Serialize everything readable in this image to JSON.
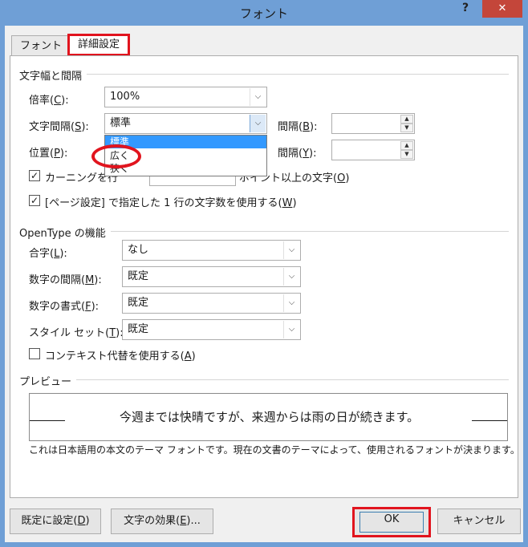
{
  "window": {
    "title": "フォント",
    "help": "?",
    "close": "✕"
  },
  "tabs": [
    {
      "label": "フォント"
    },
    {
      "label": "詳細設定"
    }
  ],
  "spacing_section": {
    "title": "文字幅と間隔",
    "scale": {
      "label": "倍率(",
      "key": "C",
      "suffix": "):",
      "value": "100%"
    },
    "spacing": {
      "label": "文字間隔(",
      "key": "S",
      "suffix": "):",
      "value": "標準"
    },
    "spacing_by": {
      "label": "間隔(",
      "key": "B",
      "suffix": "):",
      "value": ""
    },
    "position": {
      "label": "位置(",
      "key": "P",
      "suffix": "):"
    },
    "position_by": {
      "label": "間隔(",
      "key": "Y",
      "suffix": "):",
      "value": ""
    },
    "kerning": {
      "label_visible": "カーニングを行",
      "tail": "ポイント以上の文字(",
      "key": "O",
      "suffix": ")",
      "checked": true
    },
    "grid": {
      "label": "[ページ設定] で指定した 1 行の文字数を使用する(",
      "key": "W",
      "suffix": ")",
      "checked": true
    }
  },
  "dropdown": {
    "options": [
      "標準",
      "広く",
      "狭く"
    ],
    "selected": "標準"
  },
  "opentype_section": {
    "title": "OpenType の機能",
    "ligatures": {
      "label": "合字(",
      "key": "L",
      "suffix": "):",
      "value": "なし"
    },
    "number_spacing": {
      "label": "数字の間隔(",
      "key": "M",
      "suffix": "):",
      "value": "既定"
    },
    "number_forms": {
      "label": "数字の書式(",
      "key": "F",
      "suffix": "):",
      "value": "既定"
    },
    "stylistic_sets": {
      "label": "スタイル セット(",
      "key": "T",
      "suffix": "):",
      "value": "既定"
    },
    "contextual": {
      "label": "コンテキスト代替を使用する(",
      "key": "A",
      "suffix": ")",
      "checked": false
    }
  },
  "preview": {
    "title": "プレビュー",
    "sample": "今週までは快晴ですが、来週からは雨の日が続きます。",
    "note": "これは日本語用の本文のテーマ フォントです。現在の文書のテーマによって、使用されるフォントが決まります。"
  },
  "buttons": {
    "set_default": {
      "label": "既定に設定(",
      "key": "D",
      "suffix": ")"
    },
    "text_effects": {
      "label": "文字の効果(",
      "key": "E",
      "suffix": ")..."
    },
    "ok": "OK",
    "cancel": "キャンセル"
  },
  "colors": {
    "titlebar": "#6f9fd6",
    "highlight": "#e1141e",
    "selection": "#3399ff",
    "close": "#c4463a"
  }
}
